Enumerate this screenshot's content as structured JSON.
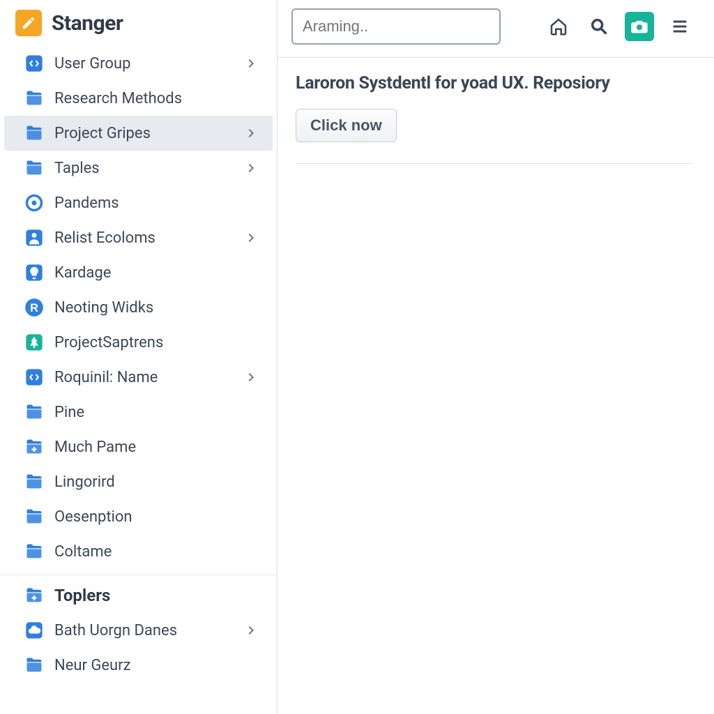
{
  "app": {
    "name": "Stanger"
  },
  "search": {
    "placeholder": "Araming.."
  },
  "sidebar": {
    "groups": [
      {
        "items": [
          {
            "label": "User Group",
            "icon": "code-square",
            "expandable": true
          },
          {
            "label": "Research Methods",
            "icon": "folder",
            "expandable": false
          },
          {
            "label": "Project Gripes",
            "icon": "folder",
            "expandable": true,
            "selected": true
          },
          {
            "label": "Taples",
            "icon": "folder",
            "expandable": true
          },
          {
            "label": "Pandems",
            "icon": "circle-dot",
            "expandable": false
          },
          {
            "label": "Relist Ecoloms",
            "icon": "person-square",
            "expandable": true
          },
          {
            "label": "Kardage",
            "icon": "bulb-square",
            "expandable": false
          },
          {
            "label": "Neoting Widks",
            "icon": "circle-r",
            "expandable": false
          },
          {
            "label": "ProjectSaptrens",
            "icon": "tree-square",
            "expandable": false
          },
          {
            "label": "Roquinil: Name",
            "icon": "code-square",
            "expandable": true
          },
          {
            "label": "Pine",
            "icon": "folder",
            "expandable": false
          },
          {
            "label": "Much Pame",
            "icon": "folder-plus",
            "expandable": false
          },
          {
            "label": "Lingorird",
            "icon": "folder",
            "expandable": false
          },
          {
            "label": "Oesenption",
            "icon": "folder",
            "expandable": false
          },
          {
            "label": "Coltame",
            "icon": "folder",
            "expandable": false
          }
        ]
      },
      {
        "items": [
          {
            "label": "Toplers",
            "icon": "folder-plus",
            "expandable": false,
            "heading": true
          },
          {
            "label": "Bath Uorgn Danes",
            "icon": "cloud-square",
            "expandable": true
          },
          {
            "label": "Neur Geurz",
            "icon": "folder",
            "expandable": false
          }
        ]
      }
    ]
  },
  "page": {
    "title": "Laroron Systdentl for yoad UX. Reposiory",
    "cta": "Click now"
  },
  "colors": {
    "accent_orange": "#f5a623",
    "accent_blue": "#2f7fe0",
    "accent_teal": "#17b39a"
  }
}
